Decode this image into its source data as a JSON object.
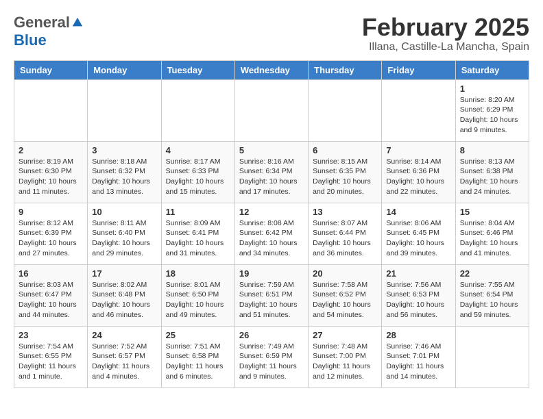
{
  "logo": {
    "general": "General",
    "blue": "Blue"
  },
  "title": "February 2025",
  "subtitle": "Illana, Castille-La Mancha, Spain",
  "days_of_week": [
    "Sunday",
    "Monday",
    "Tuesday",
    "Wednesday",
    "Thursday",
    "Friday",
    "Saturday"
  ],
  "weeks": [
    [
      {
        "day": "",
        "info": ""
      },
      {
        "day": "",
        "info": ""
      },
      {
        "day": "",
        "info": ""
      },
      {
        "day": "",
        "info": ""
      },
      {
        "day": "",
        "info": ""
      },
      {
        "day": "",
        "info": ""
      },
      {
        "day": "1",
        "info": "Sunrise: 8:20 AM\nSunset: 6:29 PM\nDaylight: 10 hours and 9 minutes."
      }
    ],
    [
      {
        "day": "2",
        "info": "Sunrise: 8:19 AM\nSunset: 6:30 PM\nDaylight: 10 hours and 11 minutes."
      },
      {
        "day": "3",
        "info": "Sunrise: 8:18 AM\nSunset: 6:32 PM\nDaylight: 10 hours and 13 minutes."
      },
      {
        "day": "4",
        "info": "Sunrise: 8:17 AM\nSunset: 6:33 PM\nDaylight: 10 hours and 15 minutes."
      },
      {
        "day": "5",
        "info": "Sunrise: 8:16 AM\nSunset: 6:34 PM\nDaylight: 10 hours and 17 minutes."
      },
      {
        "day": "6",
        "info": "Sunrise: 8:15 AM\nSunset: 6:35 PM\nDaylight: 10 hours and 20 minutes."
      },
      {
        "day": "7",
        "info": "Sunrise: 8:14 AM\nSunset: 6:36 PM\nDaylight: 10 hours and 22 minutes."
      },
      {
        "day": "8",
        "info": "Sunrise: 8:13 AM\nSunset: 6:38 PM\nDaylight: 10 hours and 24 minutes."
      }
    ],
    [
      {
        "day": "9",
        "info": "Sunrise: 8:12 AM\nSunset: 6:39 PM\nDaylight: 10 hours and 27 minutes."
      },
      {
        "day": "10",
        "info": "Sunrise: 8:11 AM\nSunset: 6:40 PM\nDaylight: 10 hours and 29 minutes."
      },
      {
        "day": "11",
        "info": "Sunrise: 8:09 AM\nSunset: 6:41 PM\nDaylight: 10 hours and 31 minutes."
      },
      {
        "day": "12",
        "info": "Sunrise: 8:08 AM\nSunset: 6:42 PM\nDaylight: 10 hours and 34 minutes."
      },
      {
        "day": "13",
        "info": "Sunrise: 8:07 AM\nSunset: 6:44 PM\nDaylight: 10 hours and 36 minutes."
      },
      {
        "day": "14",
        "info": "Sunrise: 8:06 AM\nSunset: 6:45 PM\nDaylight: 10 hours and 39 minutes."
      },
      {
        "day": "15",
        "info": "Sunrise: 8:04 AM\nSunset: 6:46 PM\nDaylight: 10 hours and 41 minutes."
      }
    ],
    [
      {
        "day": "16",
        "info": "Sunrise: 8:03 AM\nSunset: 6:47 PM\nDaylight: 10 hours and 44 minutes."
      },
      {
        "day": "17",
        "info": "Sunrise: 8:02 AM\nSunset: 6:48 PM\nDaylight: 10 hours and 46 minutes."
      },
      {
        "day": "18",
        "info": "Sunrise: 8:01 AM\nSunset: 6:50 PM\nDaylight: 10 hours and 49 minutes."
      },
      {
        "day": "19",
        "info": "Sunrise: 7:59 AM\nSunset: 6:51 PM\nDaylight: 10 hours and 51 minutes."
      },
      {
        "day": "20",
        "info": "Sunrise: 7:58 AM\nSunset: 6:52 PM\nDaylight: 10 hours and 54 minutes."
      },
      {
        "day": "21",
        "info": "Sunrise: 7:56 AM\nSunset: 6:53 PM\nDaylight: 10 hours and 56 minutes."
      },
      {
        "day": "22",
        "info": "Sunrise: 7:55 AM\nSunset: 6:54 PM\nDaylight: 10 hours and 59 minutes."
      }
    ],
    [
      {
        "day": "23",
        "info": "Sunrise: 7:54 AM\nSunset: 6:55 PM\nDaylight: 11 hours and 1 minute."
      },
      {
        "day": "24",
        "info": "Sunrise: 7:52 AM\nSunset: 6:57 PM\nDaylight: 11 hours and 4 minutes."
      },
      {
        "day": "25",
        "info": "Sunrise: 7:51 AM\nSunset: 6:58 PM\nDaylight: 11 hours and 6 minutes."
      },
      {
        "day": "26",
        "info": "Sunrise: 7:49 AM\nSunset: 6:59 PM\nDaylight: 11 hours and 9 minutes."
      },
      {
        "day": "27",
        "info": "Sunrise: 7:48 AM\nSunset: 7:00 PM\nDaylight: 11 hours and 12 minutes."
      },
      {
        "day": "28",
        "info": "Sunrise: 7:46 AM\nSunset: 7:01 PM\nDaylight: 11 hours and 14 minutes."
      },
      {
        "day": "",
        "info": ""
      }
    ]
  ]
}
